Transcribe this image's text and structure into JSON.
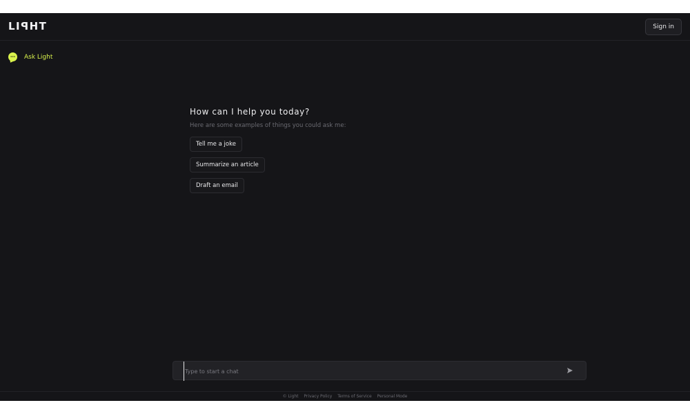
{
  "header": {
    "logo_text": "LIꟼHT",
    "sign_in_label": "Sign in"
  },
  "sidebar": {
    "items": [
      {
        "label": "Ask Light",
        "icon": "chat-bubble-icon"
      }
    ]
  },
  "welcome": {
    "title": "How can I help you today?",
    "subtitle": "Here are some examples of things you could ask me:",
    "suggestions": [
      {
        "label": "Tell me a joke"
      },
      {
        "label": "Summarize an article"
      },
      {
        "label": "Draft an email"
      }
    ]
  },
  "composer": {
    "placeholder": "Type to start a chat",
    "value": "",
    "send_icon": "send-arrow-icon"
  },
  "footer": {
    "copyright": "© Light",
    "links": [
      "Privacy Policy",
      "Terms of Service",
      "Personal Mode"
    ]
  },
  "colors": {
    "background": "#151518",
    "accent": "#d9f24c",
    "muted_text": "#6b6b72"
  }
}
